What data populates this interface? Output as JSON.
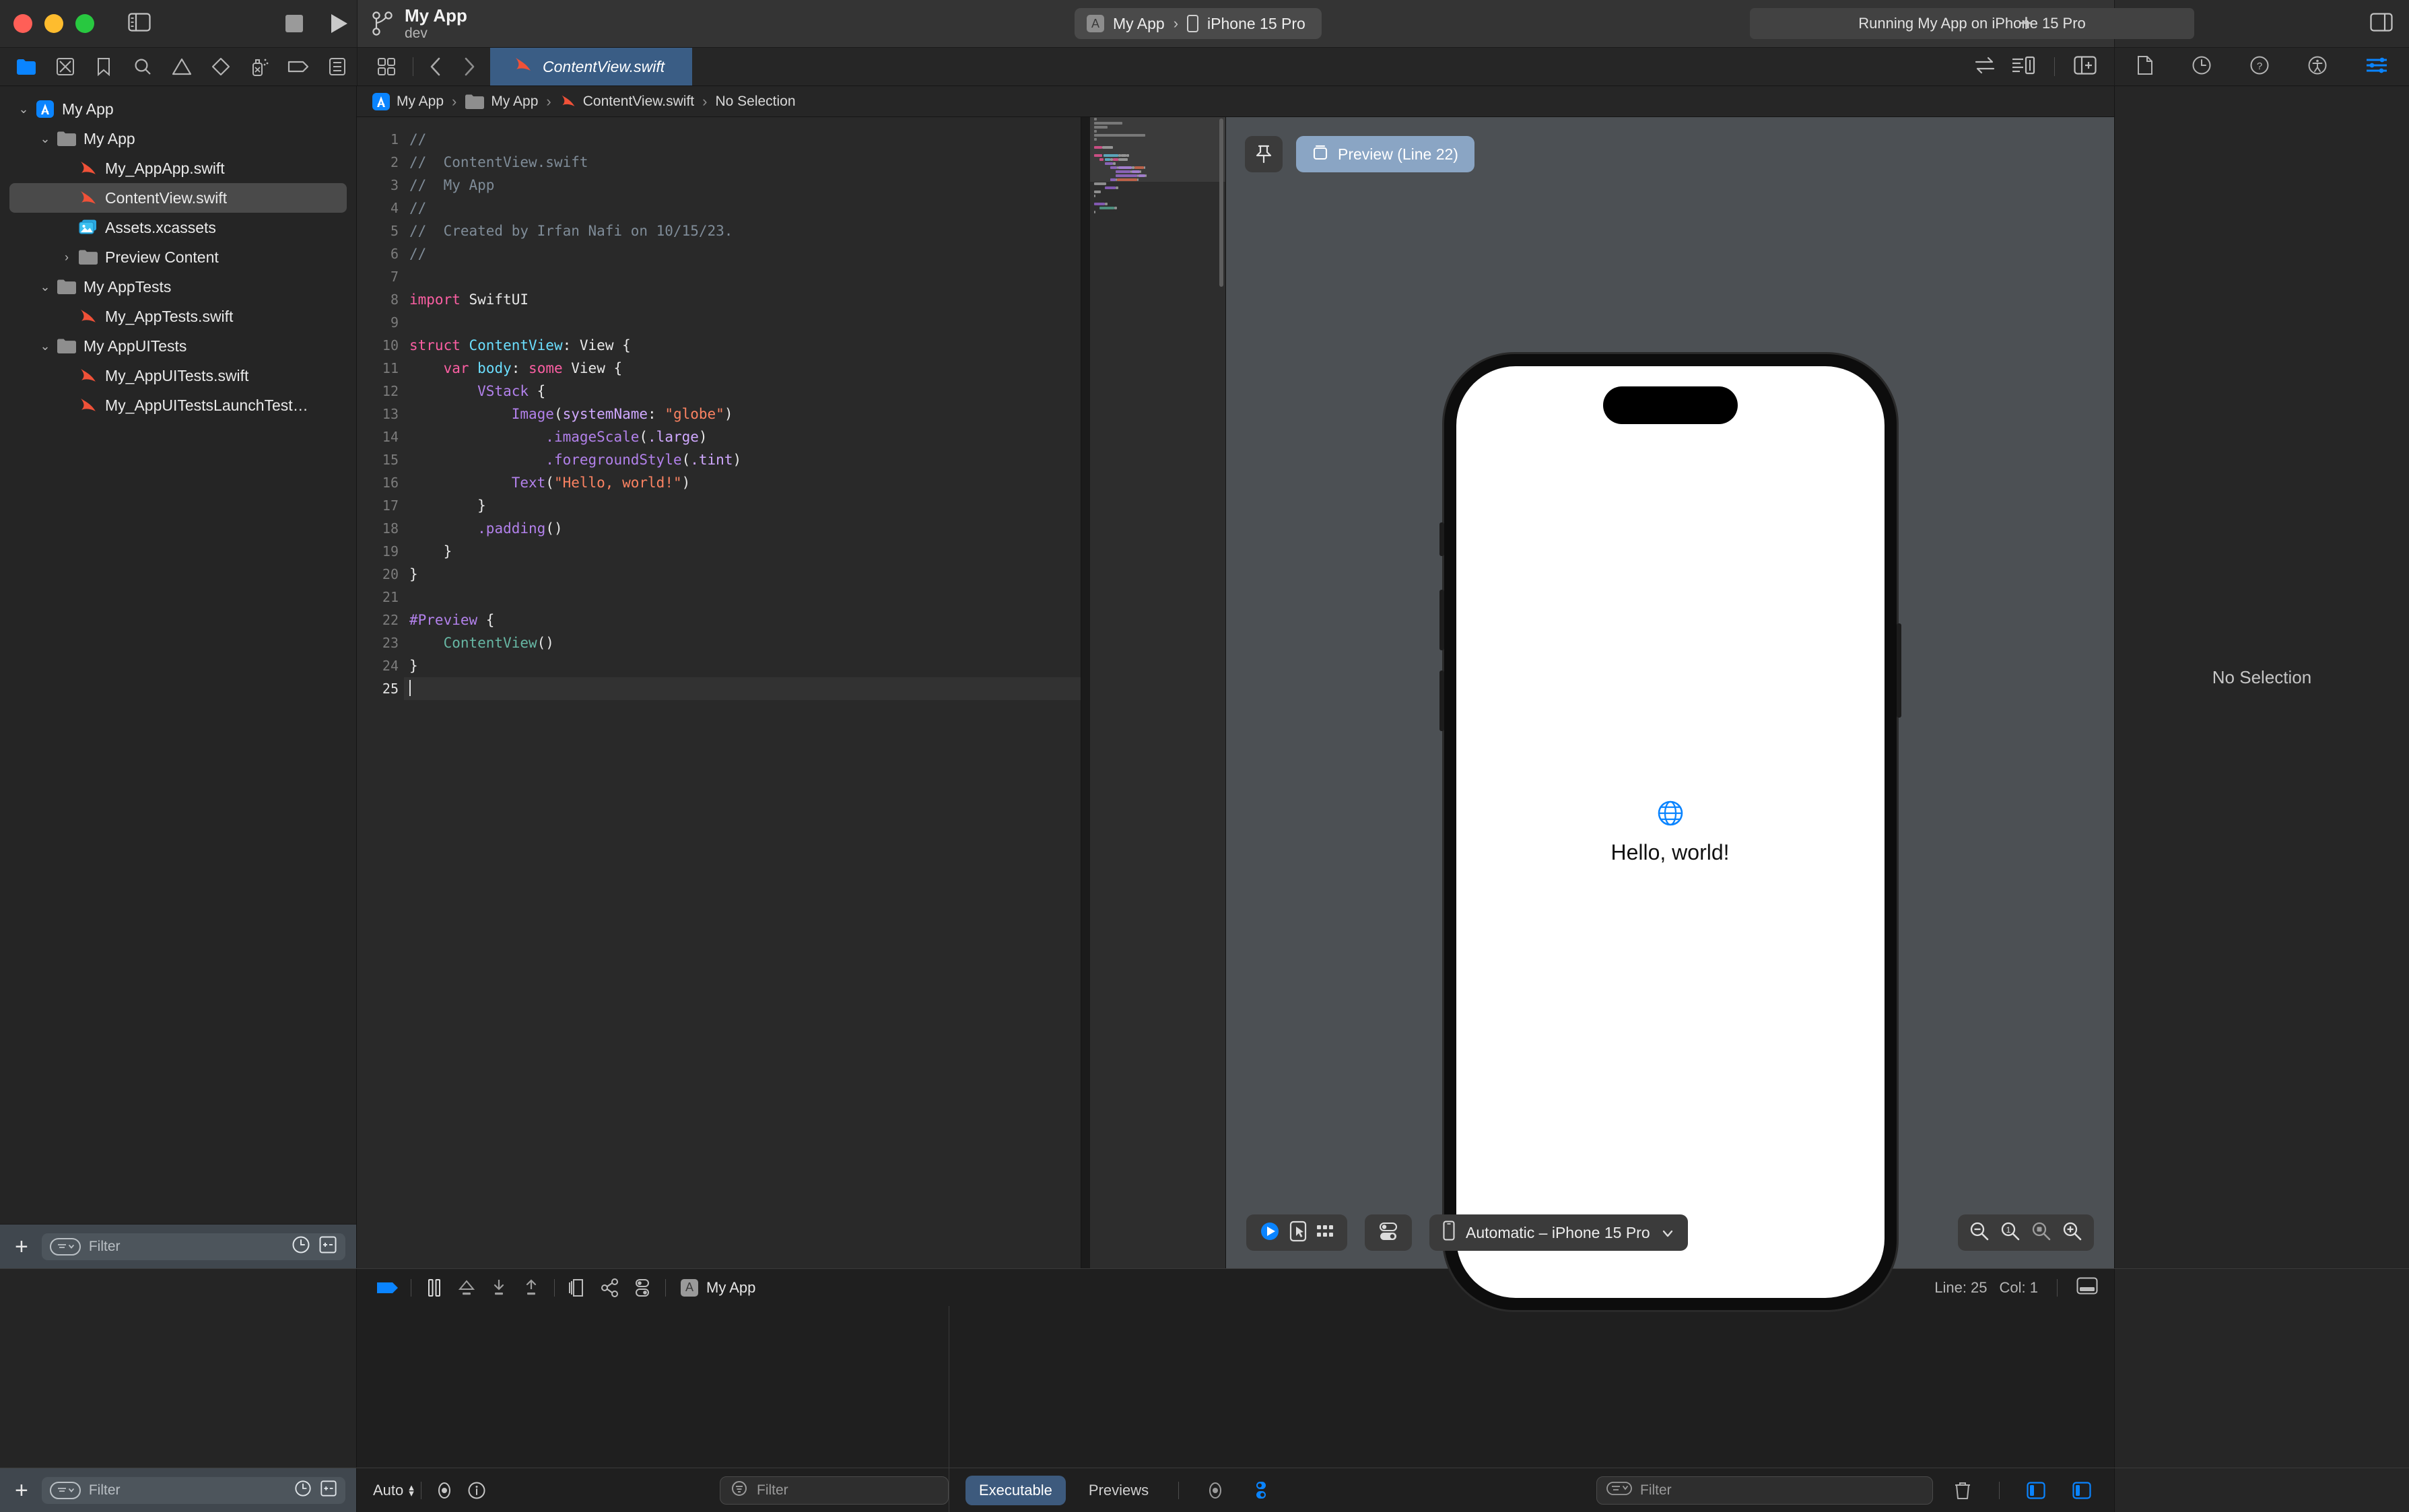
{
  "window": {
    "project_title": "My App",
    "project_branch": "dev",
    "scheme_name": "My App",
    "scheme_separator": "›",
    "destination": "iPhone 15 Pro",
    "status": "Running My App on iPhone 15 Pro",
    "add_button": "+"
  },
  "navigator_toolbar": {
    "icons": [
      {
        "name": "project-navigator-icon",
        "label": "folder"
      },
      {
        "name": "source-control-navigator-icon",
        "label": "source-control"
      },
      {
        "name": "bookmark-navigator-icon",
        "label": "bookmark"
      },
      {
        "name": "find-navigator-icon",
        "label": "search"
      },
      {
        "name": "issue-navigator-icon",
        "label": "warning"
      },
      {
        "name": "test-navigator-icon",
        "label": "diamond"
      },
      {
        "name": "debug-navigator-icon",
        "label": "spray"
      },
      {
        "name": "breakpoint-navigator-icon",
        "label": "tag"
      },
      {
        "name": "report-navigator-icon",
        "label": "report"
      }
    ]
  },
  "file_tree": [
    {
      "label": "My App",
      "indent": 0,
      "icon": "xcode-project-icon",
      "twisty": "⌄",
      "selected": false
    },
    {
      "label": "My App",
      "indent": 1,
      "icon": "folder-icon",
      "twisty": "⌄",
      "selected": false
    },
    {
      "label": "My_AppApp.swift",
      "indent": 2,
      "icon": "swift-file-icon",
      "twisty": "",
      "selected": false
    },
    {
      "label": "ContentView.swift",
      "indent": 2,
      "icon": "swift-file-icon",
      "twisty": "",
      "selected": true
    },
    {
      "label": "Assets.xcassets",
      "indent": 2,
      "icon": "assets-icon",
      "twisty": "",
      "selected": false
    },
    {
      "label": "Preview Content",
      "indent": 2,
      "icon": "folder-icon",
      "twisty": "›",
      "selected": false
    },
    {
      "label": "My AppTests",
      "indent": 1,
      "icon": "folder-icon",
      "twisty": "⌄",
      "selected": false
    },
    {
      "label": "My_AppTests.swift",
      "indent": 2,
      "icon": "swift-file-icon",
      "twisty": "",
      "selected": false
    },
    {
      "label": "My AppUITests",
      "indent": 1,
      "icon": "folder-icon",
      "twisty": "⌄",
      "selected": false
    },
    {
      "label": "My_AppUITests.swift",
      "indent": 2,
      "icon": "swift-file-icon",
      "twisty": "",
      "selected": false
    },
    {
      "label": "My_AppUITestsLaunchTest…",
      "indent": 2,
      "icon": "swift-file-icon",
      "twisty": "",
      "selected": false
    }
  ],
  "navigator_footer": {
    "add_label": "+",
    "filter_placeholder": "Filter"
  },
  "editor": {
    "tab_label": "ContentView.swift",
    "breadcrumb": [
      "My App",
      "My App",
      "ContentView.swift",
      "No Selection"
    ],
    "cursor_line": 25,
    "cursor_col": 1,
    "status_line_label": "Line: 25",
    "status_col_label": "Col: 1",
    "code_lines": [
      {
        "n": 1,
        "tokens": [
          {
            "t": "//",
            "c": "cm"
          }
        ]
      },
      {
        "n": 2,
        "tokens": [
          {
            "t": "//  ContentView.swift",
            "c": "cm"
          }
        ]
      },
      {
        "n": 3,
        "tokens": [
          {
            "t": "//  My App",
            "c": "cm"
          }
        ]
      },
      {
        "n": 4,
        "tokens": [
          {
            "t": "//",
            "c": "cm"
          }
        ]
      },
      {
        "n": 5,
        "tokens": [
          {
            "t": "//  Created by Irfan Nafi on 10/15/23.",
            "c": "cm"
          }
        ]
      },
      {
        "n": 6,
        "tokens": [
          {
            "t": "//",
            "c": "cm"
          }
        ]
      },
      {
        "n": 7,
        "tokens": []
      },
      {
        "n": 8,
        "tokens": [
          {
            "t": "import",
            "c": "kw"
          },
          {
            "t": " SwiftUI",
            "c": "pn"
          }
        ]
      },
      {
        "n": 9,
        "tokens": []
      },
      {
        "n": 10,
        "tokens": [
          {
            "t": "struct",
            "c": "kw"
          },
          {
            "t": " ",
            "c": "pn"
          },
          {
            "t": "ContentView",
            "c": "ty"
          },
          {
            "t": ": ",
            "c": "pn"
          },
          {
            "t": "View",
            "c": "pn"
          },
          {
            "t": " {",
            "c": "pn"
          }
        ]
      },
      {
        "n": 11,
        "tokens": [
          {
            "t": "    ",
            "c": "pn"
          },
          {
            "t": "var",
            "c": "kw"
          },
          {
            "t": " ",
            "c": "pn"
          },
          {
            "t": "body",
            "c": "ty"
          },
          {
            "t": ": ",
            "c": "pn"
          },
          {
            "t": "some",
            "c": "kw"
          },
          {
            "t": " View {",
            "c": "pn"
          }
        ]
      },
      {
        "n": 12,
        "tokens": [
          {
            "t": "        ",
            "c": "pn"
          },
          {
            "t": "VStack",
            "c": "fn"
          },
          {
            "t": " {",
            "c": "pn"
          }
        ]
      },
      {
        "n": 13,
        "tokens": [
          {
            "t": "            ",
            "c": "pn"
          },
          {
            "t": "Image",
            "c": "fn"
          },
          {
            "t": "(",
            "c": "pn"
          },
          {
            "t": "systemName",
            "c": "pl"
          },
          {
            "t": ": ",
            "c": "pn"
          },
          {
            "t": "\"globe\"",
            "c": "st"
          },
          {
            "t": ")",
            "c": "pn"
          }
        ]
      },
      {
        "n": 14,
        "tokens": [
          {
            "t": "                ",
            "c": "pn"
          },
          {
            "t": ".imageScale",
            "c": "fn"
          },
          {
            "t": "(",
            "c": "pn"
          },
          {
            "t": ".large",
            "c": "pl"
          },
          {
            "t": ")",
            "c": "pn"
          }
        ]
      },
      {
        "n": 15,
        "tokens": [
          {
            "t": "                ",
            "c": "pn"
          },
          {
            "t": ".foregroundStyle",
            "c": "fn"
          },
          {
            "t": "(",
            "c": "pn"
          },
          {
            "t": ".tint",
            "c": "pl"
          },
          {
            "t": ")",
            "c": "pn"
          }
        ]
      },
      {
        "n": 16,
        "tokens": [
          {
            "t": "            ",
            "c": "pn"
          },
          {
            "t": "Text",
            "c": "fn"
          },
          {
            "t": "(",
            "c": "pn"
          },
          {
            "t": "\"Hello, world!\"",
            "c": "st"
          },
          {
            "t": ")",
            "c": "pn"
          }
        ]
      },
      {
        "n": 17,
        "tokens": [
          {
            "t": "        }",
            "c": "pn"
          }
        ]
      },
      {
        "n": 18,
        "tokens": [
          {
            "t": "        ",
            "c": "pn"
          },
          {
            "t": ".padding",
            "c": "fn"
          },
          {
            "t": "()",
            "c": "pn"
          }
        ]
      },
      {
        "n": 19,
        "tokens": [
          {
            "t": "    }",
            "c": "pn"
          }
        ]
      },
      {
        "n": 20,
        "tokens": [
          {
            "t": "}",
            "c": "pn"
          }
        ]
      },
      {
        "n": 21,
        "tokens": []
      },
      {
        "n": 22,
        "tokens": [
          {
            "t": "#Preview",
            "c": "fn"
          },
          {
            "t": " {",
            "c": "pn"
          }
        ]
      },
      {
        "n": 23,
        "tokens": [
          {
            "t": "    ",
            "c": "pn"
          },
          {
            "t": "ContentView",
            "c": "gr"
          },
          {
            "t": "()",
            "c": "pn"
          }
        ]
      },
      {
        "n": 24,
        "tokens": [
          {
            "t": "}",
            "c": "pn"
          }
        ]
      },
      {
        "n": 25,
        "tokens": []
      }
    ]
  },
  "canvas": {
    "pin_icon": "pin-icon",
    "preview_label": "Preview (Line 22)",
    "preview_body_text": "Hello, world!",
    "preview_glyph": "globe-icon",
    "device_popup_label": "Automatic – iPhone 15 Pro",
    "device_popup_chevron": "⌄",
    "zoom_buttons": [
      "zoom-out-icon",
      "zoom-100-icon",
      "zoom-fit-icon",
      "zoom-in-icon"
    ]
  },
  "inspector": {
    "tabs": [
      "file-inspector-icon",
      "history-inspector-icon",
      "help-inspector-icon",
      "accessibility-inspector-icon",
      "attributes-inspector-icon"
    ],
    "selected_tab_index": 4,
    "empty_message": "No Selection"
  },
  "debug_bar": {
    "icons": [
      "debug-area-toggle-icon",
      "pause-icon",
      "step-over-icon",
      "step-into-icon",
      "step-out-icon",
      "stack-frames-icon",
      "view-hierarchy-icon",
      "debug-settings-icon"
    ],
    "process_label": "My App"
  },
  "console_bar": {
    "auto_label": "Auto",
    "variables_filter_placeholder": "Filter",
    "output_tabs": [
      "Executable",
      "Previews"
    ],
    "selected_output_tab": "Executable",
    "output_filter_placeholder": "Filter",
    "trash_icon": "trash-icon"
  },
  "colors": {
    "accent_blue": "#0a84ff",
    "tab_active_bg": "#3a5d85",
    "preview_pill_bg": "#8aa5c4",
    "executable_pill_bg": "#3d5a7d",
    "swift_orange": "#f05138",
    "comment_gray": "#7f8c98",
    "keyword_pink": "#fc5fa3",
    "type_cyan": "#6bdfff",
    "string_orange": "#fc8362",
    "func_purple": "#b281eb"
  }
}
